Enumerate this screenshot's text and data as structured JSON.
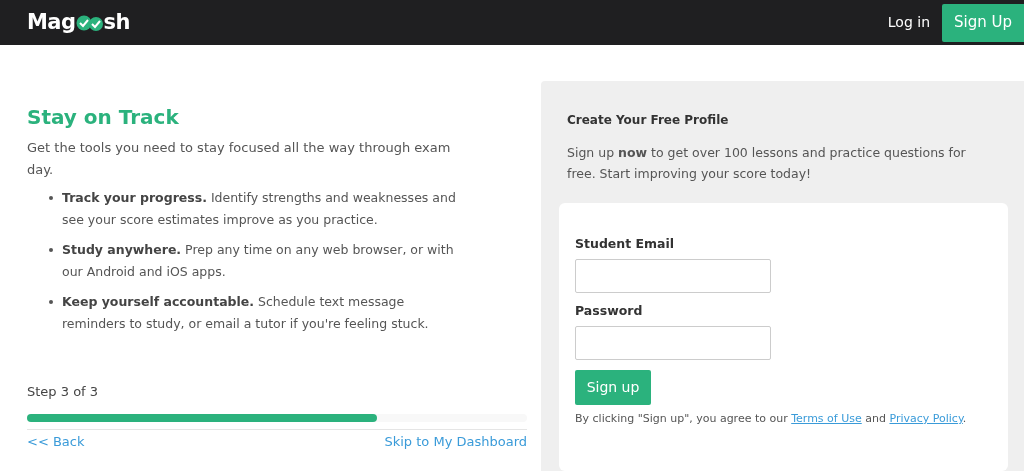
{
  "header": {
    "logo": {
      "before": "Mag",
      "after": "sh"
    },
    "login": "Log in",
    "signup": "Sign Up"
  },
  "left": {
    "title": "Stay on Track",
    "intro": "Get the tools you need to stay focused all the way through exam day.",
    "bullets": [
      {
        "lead": "Track your progress.",
        "text": "Identify strengths and weaknesses and see your score estimates improve as you practice."
      },
      {
        "lead": "Study anywhere.",
        "text": "Prep any time on any web browser, or with our Android and iOS apps."
      },
      {
        "lead": "Keep yourself accountable.",
        "text": "Schedule text message reminders to study, or email a tutor if you're feeling stuck."
      }
    ],
    "step": "Step 3 of 3",
    "progress": {
      "level": 0.7
    },
    "back": "<< Back",
    "skip": "Skip to My Dashboard"
  },
  "right": {
    "title": "Create Your Free Profile",
    "intro": "Sign up **now** to get over 100 lessons and practice questions for free. Start improving your score today!",
    "fields": [
      {
        "label": "Student Email"
      },
      {
        "label": "Password"
      }
    ],
    "submit": "Sign up",
    "terms": {
      "before": "By clicking \"Sign up\", you agree to our ",
      "link1": "Terms of Use",
      "middle": " and ",
      "link2": "Privacy Policy",
      "after": "."
    }
  }
}
